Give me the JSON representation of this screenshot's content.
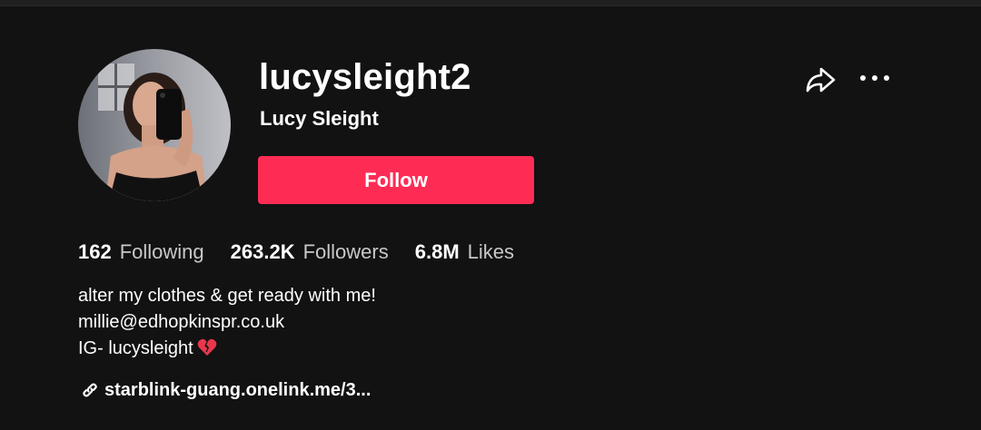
{
  "profile": {
    "username": "lucysleight2",
    "display_name": "Lucy Sleight",
    "follow_label": "Follow"
  },
  "stats": {
    "following": {
      "count": "162",
      "label": "Following"
    },
    "followers": {
      "count": "263.2K",
      "label": "Followers"
    },
    "likes": {
      "count": "6.8M",
      "label": "Likes"
    }
  },
  "bio": {
    "line1": "alter my clothes & get ready with me!",
    "line2": "millie@edhopkinspr.co.uk",
    "line3": "IG- lucysleight",
    "line3_emoji_icon": "broken-heart-icon"
  },
  "link": {
    "text": "starblink-guang.onelink.me/3...",
    "icon": "link-icon"
  },
  "actions": {
    "share_icon": "share-icon",
    "more_icon": "more-icon"
  },
  "colors": {
    "background": "#121212",
    "accent": "#fe2c55",
    "secondary_text": "#c8c8c8"
  }
}
